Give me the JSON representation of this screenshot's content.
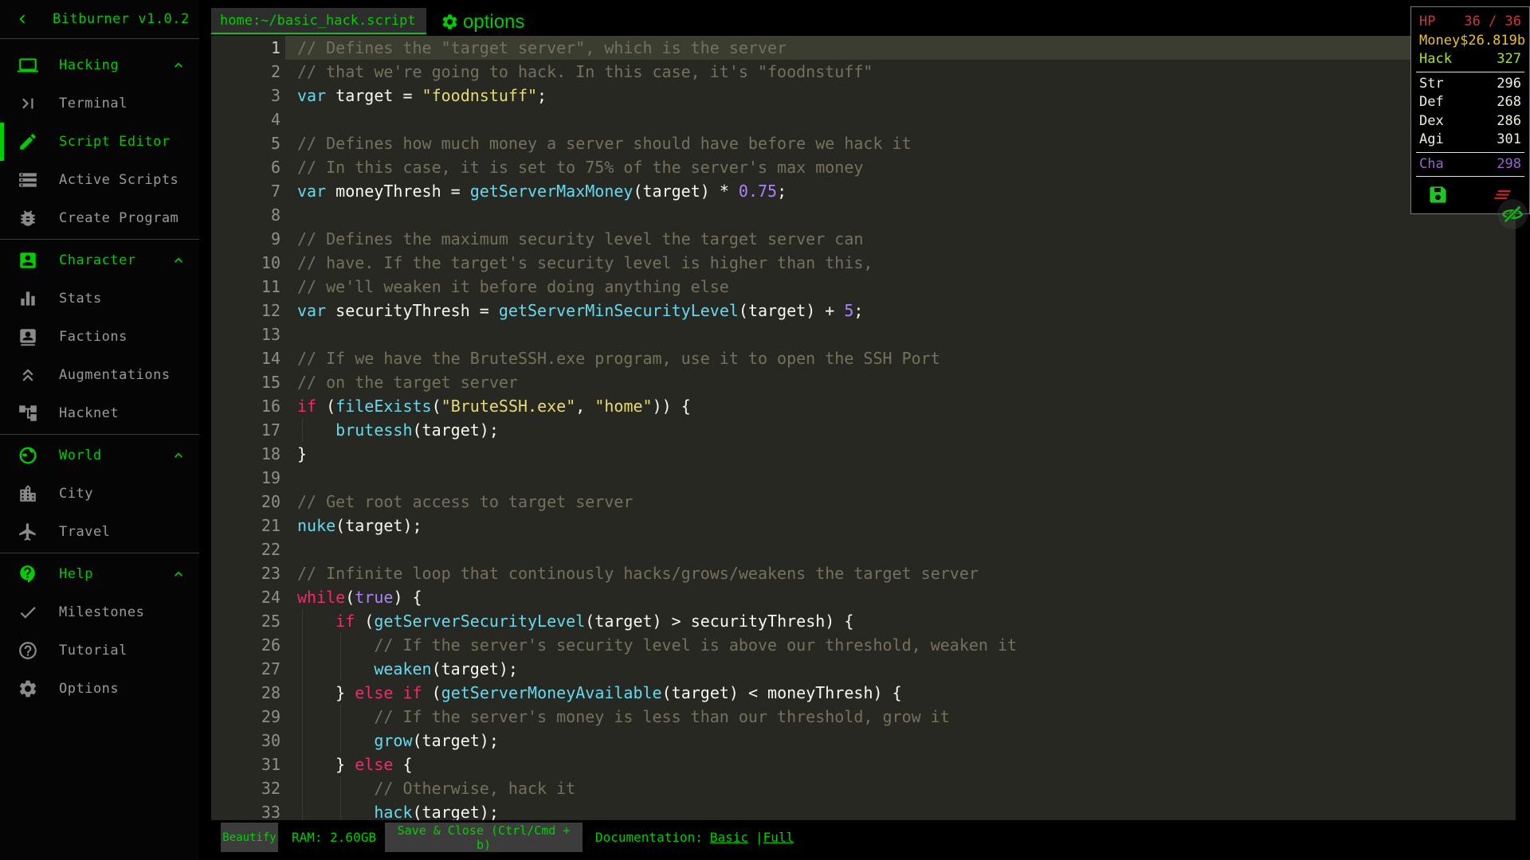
{
  "app": {
    "version_title": "Bitburner v1.0.2",
    "back_icon": "chevron-left-icon"
  },
  "sidebar": {
    "sections": [
      {
        "label": "Hacking",
        "icon": "laptop-icon",
        "expanded": true,
        "items": [
          {
            "label": "Terminal",
            "icon": "terminal-icon"
          },
          {
            "label": "Script Editor",
            "icon": "pencil-icon",
            "active": true
          },
          {
            "label": "Active Scripts",
            "icon": "scripts-icon"
          },
          {
            "label": "Create Program",
            "icon": "bug-icon"
          }
        ]
      },
      {
        "label": "Character",
        "icon": "person-icon",
        "expanded": true,
        "items": [
          {
            "label": "Stats",
            "icon": "stats-icon"
          },
          {
            "label": "Factions",
            "icon": "factions-icon"
          },
          {
            "label": "Augmentations",
            "icon": "augmentations-icon"
          },
          {
            "label": "Hacknet",
            "icon": "hacknet-icon"
          }
        ]
      },
      {
        "label": "World",
        "icon": "globe-icon",
        "expanded": true,
        "items": [
          {
            "label": "City",
            "icon": "city-icon"
          },
          {
            "label": "Travel",
            "icon": "plane-icon"
          }
        ]
      },
      {
        "label": "Help",
        "icon": "help-icon",
        "expanded": true,
        "items": [
          {
            "label": "Milestones",
            "icon": "check-icon"
          },
          {
            "label": "Tutorial",
            "icon": "question-icon"
          },
          {
            "label": "Options",
            "icon": "gear-icon"
          }
        ]
      }
    ]
  },
  "editor": {
    "tab_label": "home:~/basic_hack.script",
    "options_icon": "gear-icon",
    "options_label": "options",
    "code": {
      "current_line": 1,
      "lines": [
        {
          "g": 0,
          "t": [
            [
              "c",
              "// Defines the \"target server\", which is the server"
            ]
          ]
        },
        {
          "g": 0,
          "t": [
            [
              "c",
              "// that we're going to hack. In this case, it's \"foodnstuff\""
            ]
          ]
        },
        {
          "g": 0,
          "t": [
            [
              "t",
              "var"
            ],
            [
              "p",
              " target = "
            ],
            [
              "s",
              "\"foodnstuff\""
            ],
            [
              "p",
              ";"
            ]
          ]
        },
        {
          "g": 0,
          "t": []
        },
        {
          "g": 0,
          "t": [
            [
              "c",
              "// Defines how much money a server should have before we hack it"
            ]
          ]
        },
        {
          "g": 0,
          "t": [
            [
              "c",
              "// In this case, it is set to 75% of the server's max money"
            ]
          ]
        },
        {
          "g": 0,
          "t": [
            [
              "t",
              "var"
            ],
            [
              "p",
              " moneyThresh = "
            ],
            [
              "t",
              "getServerMaxMoney"
            ],
            [
              "p",
              "(target) * "
            ],
            [
              "n",
              "0.75"
            ],
            [
              "p",
              ";"
            ]
          ]
        },
        {
          "g": 0,
          "t": []
        },
        {
          "g": 0,
          "t": [
            [
              "c",
              "// Defines the maximum security level the target server can"
            ]
          ]
        },
        {
          "g": 0,
          "t": [
            [
              "c",
              "// have. If the target's security level is higher than this,"
            ]
          ]
        },
        {
          "g": 0,
          "t": [
            [
              "c",
              "// we'll weaken it before doing anything else"
            ]
          ]
        },
        {
          "g": 0,
          "t": [
            [
              "t",
              "var"
            ],
            [
              "p",
              " securityThresh = "
            ],
            [
              "t",
              "getServerMinSecurityLevel"
            ],
            [
              "p",
              "(target) + "
            ],
            [
              "n",
              "5"
            ],
            [
              "p",
              ";"
            ]
          ]
        },
        {
          "g": 0,
          "t": []
        },
        {
          "g": 0,
          "t": [
            [
              "c",
              "// If we have the BruteSSH.exe program, use it to open the SSH Port"
            ]
          ]
        },
        {
          "g": 0,
          "t": [
            [
              "c",
              "// on the target server"
            ]
          ]
        },
        {
          "g": 0,
          "t": [
            [
              "k",
              "if"
            ],
            [
              "p",
              " ("
            ],
            [
              "t",
              "fileExists"
            ],
            [
              "p",
              "("
            ],
            [
              "s",
              "\"BruteSSH.exe\""
            ],
            [
              "p",
              ", "
            ],
            [
              "s",
              "\"home\""
            ],
            [
              "p",
              ")) {"
            ]
          ]
        },
        {
          "g": 1,
          "t": [
            [
              "p",
              "    "
            ],
            [
              "t",
              "brutessh"
            ],
            [
              "p",
              "(target);"
            ]
          ]
        },
        {
          "g": 0,
          "t": [
            [
              "p",
              "}"
            ]
          ]
        },
        {
          "g": 0,
          "t": []
        },
        {
          "g": 0,
          "t": [
            [
              "c",
              "// Get root access to target server"
            ]
          ]
        },
        {
          "g": 0,
          "t": [
            [
              "t",
              "nuke"
            ],
            [
              "p",
              "(target);"
            ]
          ]
        },
        {
          "g": 0,
          "t": []
        },
        {
          "g": 0,
          "t": [
            [
              "c",
              "// Infinite loop that continously hacks/grows/weakens the target server"
            ]
          ]
        },
        {
          "g": 0,
          "t": [
            [
              "k",
              "while"
            ],
            [
              "p",
              "("
            ],
            [
              "n",
              "true"
            ],
            [
              "p",
              ") {"
            ]
          ]
        },
        {
          "g": 1,
          "t": [
            [
              "p",
              "    "
            ],
            [
              "k",
              "if"
            ],
            [
              "p",
              " ("
            ],
            [
              "t",
              "getServerSecurityLevel"
            ],
            [
              "p",
              "(target) > securityThresh) {"
            ]
          ]
        },
        {
          "g": 2,
          "t": [
            [
              "p",
              "        "
            ],
            [
              "c",
              "// If the server's security level is above our threshold, weaken it"
            ]
          ]
        },
        {
          "g": 2,
          "t": [
            [
              "p",
              "        "
            ],
            [
              "t",
              "weaken"
            ],
            [
              "p",
              "(target);"
            ]
          ]
        },
        {
          "g": 1,
          "t": [
            [
              "p",
              "    } "
            ],
            [
              "k",
              "else"
            ],
            [
              "p",
              " "
            ],
            [
              "k",
              "if"
            ],
            [
              "p",
              " ("
            ],
            [
              "t",
              "getServerMoneyAvailable"
            ],
            [
              "p",
              "(target) < moneyThresh) {"
            ]
          ]
        },
        {
          "g": 2,
          "t": [
            [
              "p",
              "        "
            ],
            [
              "c",
              "// If the server's money is less than our threshold, grow it"
            ]
          ]
        },
        {
          "g": 2,
          "t": [
            [
              "p",
              "        "
            ],
            [
              "t",
              "grow"
            ],
            [
              "p",
              "(target);"
            ]
          ]
        },
        {
          "g": 1,
          "t": [
            [
              "p",
              "    } "
            ],
            [
              "k",
              "else"
            ],
            [
              "p",
              " {"
            ]
          ]
        },
        {
          "g": 2,
          "t": [
            [
              "p",
              "        "
            ],
            [
              "c",
              "// Otherwise, hack it"
            ]
          ]
        },
        {
          "g": 2,
          "t": [
            [
              "p",
              "        "
            ],
            [
              "t",
              "hack"
            ],
            [
              "p",
              "(target);"
            ]
          ]
        }
      ]
    }
  },
  "hud": {
    "rows": [
      {
        "label": "HP",
        "value": "36 / 36",
        "color": "#cd3737",
        "divider_after": false
      },
      {
        "label": "Money",
        "value": "$26.819b",
        "color": "#edc225",
        "divider_after": false
      },
      {
        "label": "Hack",
        "value": "327",
        "color": "#a8e61d",
        "divider_after": true
      },
      {
        "label": "Str",
        "value": "296",
        "color": "#eeeedd",
        "divider_after": false
      },
      {
        "label": "Def",
        "value": "268",
        "color": "#eeeedd",
        "divider_after": false
      },
      {
        "label": "Dex",
        "value": "286",
        "color": "#eeeedd",
        "divider_after": false
      },
      {
        "label": "Agi",
        "value": "301",
        "color": "#eeeedd",
        "divider_after": true
      },
      {
        "label": "Cha",
        "value": "298",
        "color": "#9b63cf",
        "divider_after": true
      }
    ],
    "icons": [
      {
        "name": "save-icon",
        "color": "#21c521"
      },
      {
        "name": "clear-all-icon",
        "color": "#c92222"
      }
    ]
  },
  "overlay_toggle": {
    "icon": "eye-off-icon"
  },
  "statusbar": {
    "beautify": "Beautify",
    "ram": "RAM: 2.60GB",
    "save_close": "Save & Close (Ctrl/Cmd + b)",
    "documentation_label": "Documentation:",
    "doc_links": [
      "Basic",
      "Full"
    ],
    "doc_separator": "|"
  },
  "colors": {
    "accent_green": "#00cc00",
    "editor_bg": "#272822",
    "hud_hp": "#cd3737",
    "hud_money": "#edc225",
    "hud_hack": "#a8e61d",
    "hud_cha": "#9b63cf"
  }
}
